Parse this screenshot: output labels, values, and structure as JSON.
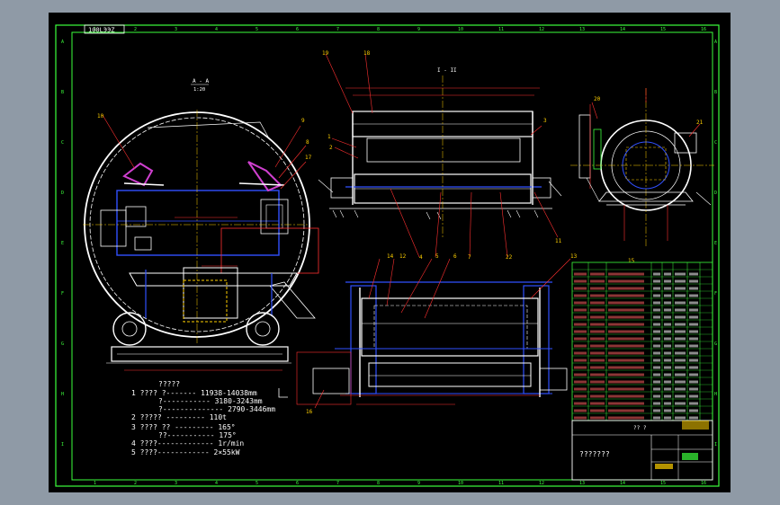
{
  "drawing": {
    "code_tag": "100LЭЭZ",
    "border_letters": [
      "A",
      "B",
      "C",
      "D",
      "E",
      "F",
      "G",
      "H",
      "I"
    ],
    "border_numbers": [
      "1",
      "2",
      "3",
      "4",
      "5",
      "6",
      "7",
      "8",
      "9",
      "10",
      "11",
      "12",
      "13",
      "14",
      "15",
      "16"
    ],
    "section_label": "A - A",
    "section_scale": "1:20",
    "view_label": "I - II",
    "part_numbers": {
      "p10": "10",
      "p9": "9",
      "p8": "8",
      "p17": "17",
      "p19": "19",
      "p18": "18",
      "p1": "1",
      "p2": "2",
      "p3": "3",
      "p20": "20",
      "p21": "21",
      "p22": "22",
      "p14": "14",
      "p12": "12",
      "p5": "5",
      "p6": "6",
      "p7": "7",
      "p8b": "8",
      "p11": "11",
      "p13": "13",
      "p15": "15",
      "p16": "16",
      "p4": "4"
    },
    "specs": {
      "heading": "?????",
      "line1": "1 ???? ?------- 11938-14038mm",
      "line1b": "?----------- 3180-3243mm",
      "line1c": "?-------------- 2790-3446mm",
      "line2": "2 ????? --------- 110t",
      "line3": "3 ???? ?? --------- 165°",
      "line3b": "??----------- 175°",
      "line4": "4 ????------------- 1r/min",
      "line5": "5 ????------------ 2×55kW"
    },
    "title_block": {
      "name": "???????",
      "remark": "?? ?"
    },
    "colors": {
      "frame": "#3cff3c",
      "outline": "#ffffff",
      "hidden": "#3050ff",
      "dim": "#ff3030",
      "center": "#ffd000",
      "accent": "#d040d0"
    }
  }
}
